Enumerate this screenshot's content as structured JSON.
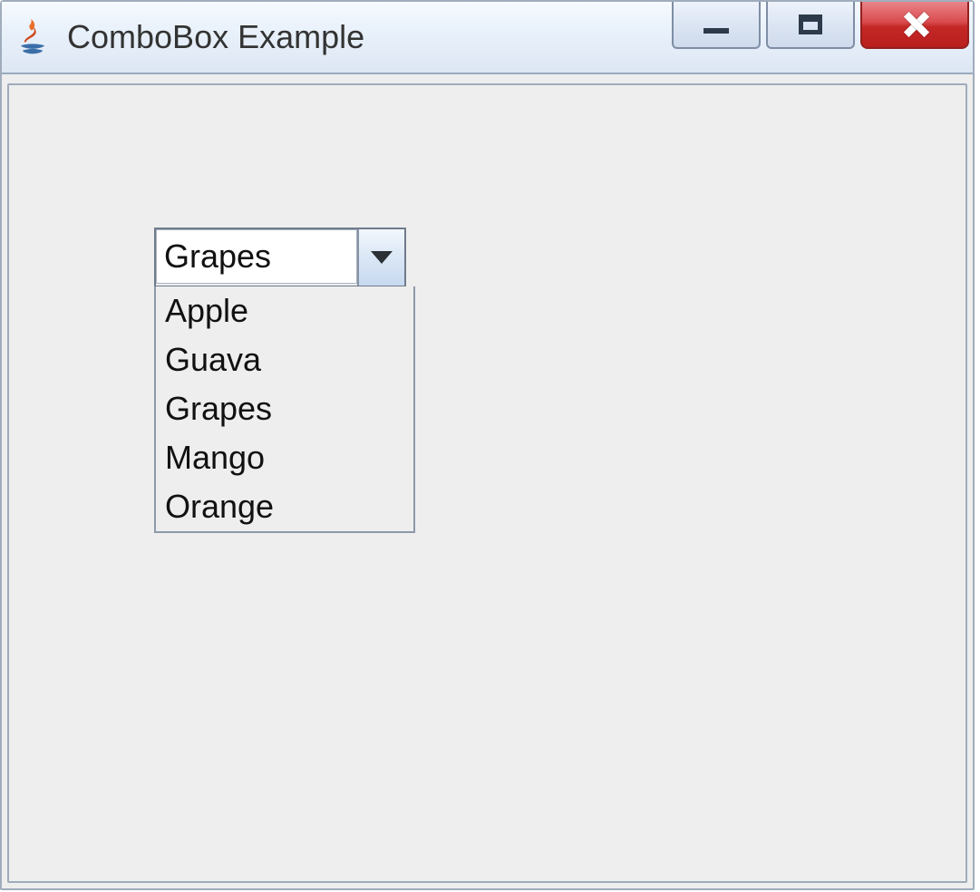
{
  "window": {
    "title": "ComboBox Example"
  },
  "combobox": {
    "selected": "Grapes",
    "options": [
      "Apple",
      "Guava",
      "Grapes",
      "Mango",
      "Orange"
    ]
  }
}
